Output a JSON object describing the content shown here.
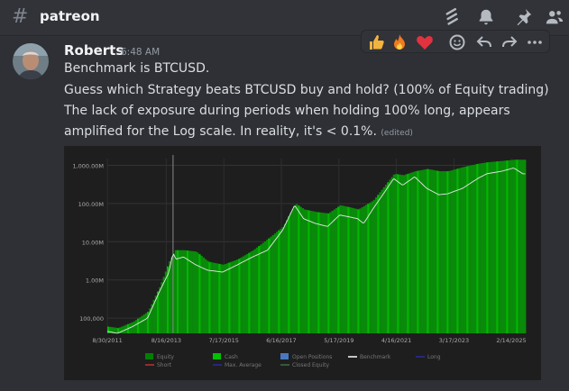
{
  "header": {
    "channel_name": "patreon",
    "icons": [
      "threads-icon",
      "bell-icon",
      "pin-icon",
      "members-icon"
    ]
  },
  "toolbar": {
    "reactions": [
      "thumbs-up-emoji",
      "fire-emoji",
      "heart-emoji"
    ],
    "actions": [
      "add-reaction-icon",
      "reply-icon",
      "forward-icon",
      "more-icon"
    ]
  },
  "message": {
    "author": "Roberts",
    "timestamp": "6:48 AM",
    "lines": [
      "Benchmark is BTCUSD.",
      "Guess which Strategy beats  BTCUSD buy and hold? (100% of Equity trading)",
      "The lack of exposure during periods when holding 100% long, appears",
      "amplified for the Log scale.  In reality, it's < 0.1%."
    ],
    "edited_label": "(edited)"
  },
  "chart_data": {
    "type": "area",
    "y_scale": "log",
    "y_ticks": [
      "1,000.00M",
      "100.00M",
      "10.00M",
      "1.00M",
      "100,000"
    ],
    "y_tick_values": [
      1000000000,
      100000000,
      10000000,
      1000000,
      100000
    ],
    "x_ticks": [
      "8/30/2011",
      "8/16/2013",
      "7/17/2015",
      "6/16/2017",
      "5/17/2019",
      "4/16/2021",
      "3/17/2023",
      "2/14/2025"
    ],
    "x_range": [
      "8/30/2011",
      "2/14/2025"
    ],
    "legend": [
      {
        "name": "Equity",
        "color": "#008000"
      },
      {
        "name": "Cash",
        "color": "#00c000"
      },
      {
        "name": "Open Positions",
        "color": "#4a78c0"
      },
      {
        "name": "Benchmark",
        "color": "#ffffff"
      },
      {
        "name": "Long",
        "color": "#2a2aa0"
      },
      {
        "name": "Short",
        "color": "#c03030"
      },
      {
        "name": "Max. Average",
        "color": "#2a2aa0"
      },
      {
        "name": "Closed Equity",
        "color": "#3c6e3c"
      }
    ],
    "legend_position": "bottom",
    "grid": true,
    "series": [
      {
        "name": "Equity",
        "years": [
          2011.66,
          2012.0,
          2012.5,
          2013.0,
          2013.4,
          2013.7,
          2013.9,
          2014.2,
          2014.6,
          2015.0,
          2015.5,
          2016.0,
          2016.5,
          2017.0,
          2017.5,
          2017.9,
          2018.2,
          2018.6,
          2019.0,
          2019.4,
          2019.7,
          2020.0,
          2020.5,
          2020.9,
          2021.2,
          2021.5,
          2021.9,
          2022.3,
          2022.7,
          2023.0,
          2023.5,
          2024.0,
          2024.3,
          2024.8,
          2025.2,
          2025.5
        ],
        "values": [
          60000,
          55000,
          80000,
          150000,
          700000,
          3000000,
          6000000,
          6000000,
          5500000,
          3000000,
          2500000,
          3500000,
          6000000,
          12000000,
          25000000,
          100000000,
          70000000,
          60000000,
          55000000,
          90000000,
          80000000,
          70000000,
          120000000,
          300000000,
          600000000,
          550000000,
          700000000,
          800000000,
          700000000,
          700000000,
          900000000,
          1100000000,
          1200000000,
          1300000000,
          1400000000,
          1400000000
        ]
      },
      {
        "name": "Benchmark",
        "years": [
          2011.66,
          2012.0,
          2012.5,
          2013.0,
          2013.4,
          2013.7,
          2013.85,
          2013.95,
          2014.2,
          2014.6,
          2015.0,
          2015.5,
          2016.0,
          2016.5,
          2017.0,
          2017.5,
          2017.9,
          2018.2,
          2018.6,
          2019.0,
          2019.4,
          2019.7,
          2020.0,
          2020.2,
          2020.5,
          2020.9,
          2021.2,
          2021.5,
          2021.9,
          2022.3,
          2022.7,
          2023.0,
          2023.5,
          2024.0,
          2024.3,
          2024.8,
          2025.2,
          2025.5
        ],
        "values": [
          45000,
          40000,
          60000,
          100000,
          500000,
          1500000,
          5000000,
          3500000,
          4000000,
          2500000,
          1800000,
          1600000,
          2500000,
          4000000,
          6000000,
          20000000,
          90000000,
          40000000,
          30000000,
          25000000,
          50000000,
          45000000,
          40000000,
          30000000,
          70000000,
          200000000,
          450000000,
          300000000,
          500000000,
          250000000,
          170000000,
          180000000,
          250000000,
          450000000,
          600000000,
          700000000,
          850000000,
          600000000
        ]
      }
    ]
  }
}
